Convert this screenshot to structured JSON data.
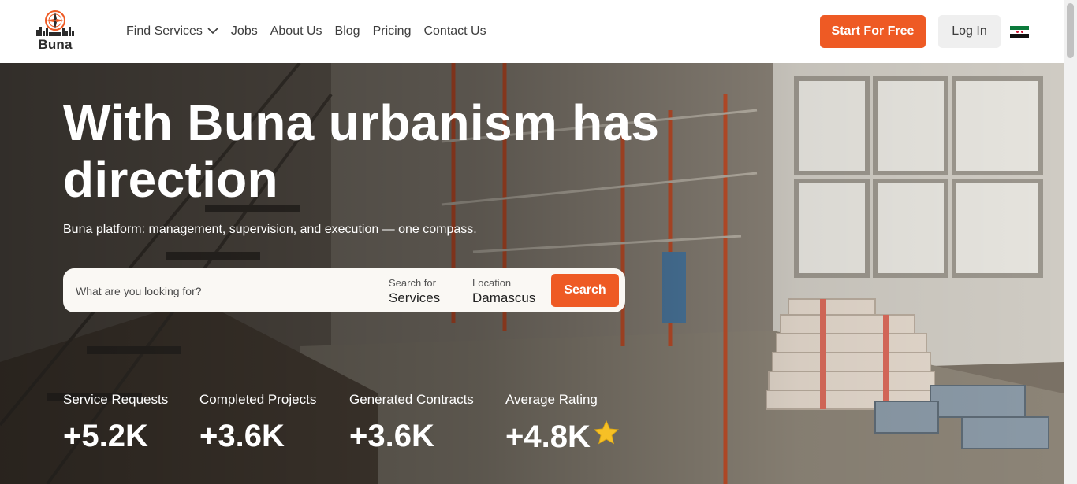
{
  "header": {
    "logo_text": "Buna",
    "nav": [
      {
        "label": "Find Services",
        "has_dropdown": true
      },
      {
        "label": "Jobs"
      },
      {
        "label": "About Us"
      },
      {
        "label": "Blog"
      },
      {
        "label": "Pricing"
      },
      {
        "label": "Contact Us"
      }
    ],
    "start_button": "Start For Free",
    "login_button": "Log In",
    "language_icon": "syria-flag-icon"
  },
  "hero": {
    "title": "With Buna urbanism has direction",
    "subtitle": "Buna platform: management, supervision, and execution — one compass.",
    "search": {
      "placeholder": "What are you looking for?",
      "search_for_label": "Search for",
      "search_for_value": "Services",
      "location_label": "Location",
      "location_value": "Damascus",
      "button": "Search"
    },
    "stats": [
      {
        "label": "Service Requests",
        "value": "+5.2K"
      },
      {
        "label": "Completed Projects",
        "value": "+3.6K"
      },
      {
        "label": "Generated Contracts",
        "value": "+3.6K"
      },
      {
        "label": "Average Rating",
        "value": "+4.8K",
        "icon": "star-icon"
      }
    ]
  },
  "colors": {
    "accent": "#ee5a24",
    "star": "#f6c026"
  }
}
